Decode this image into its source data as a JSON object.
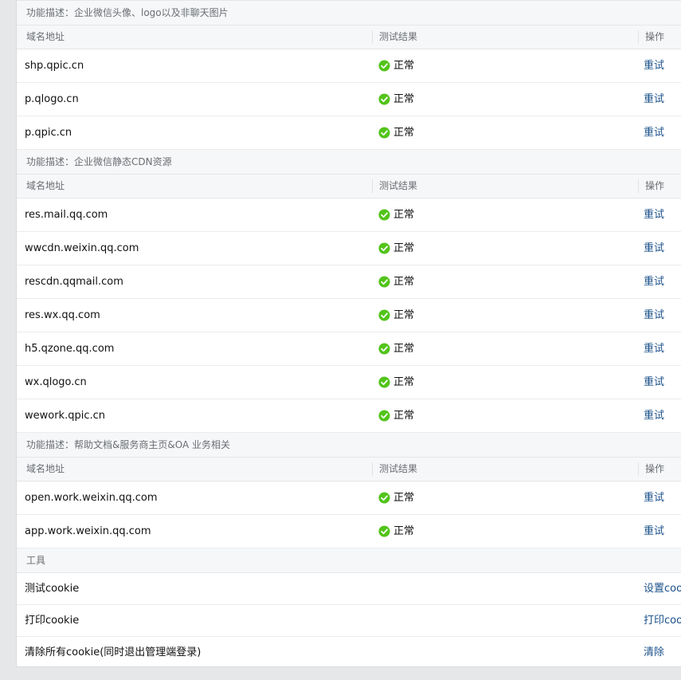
{
  "sections": [
    {
      "title": "功能描述：企业微信头像、logo以及非聊天图片",
      "headers": {
        "domain": "域名地址",
        "result": "测试结果",
        "action": "操作"
      },
      "rows": [
        {
          "domain": "shp.qpic.cn",
          "result": "正常",
          "action": "重试"
        },
        {
          "domain": "p.qlogo.cn",
          "result": "正常",
          "action": "重试"
        },
        {
          "domain": "p.qpic.cn",
          "result": "正常",
          "action": "重试"
        }
      ]
    },
    {
      "title": "功能描述：企业微信静态CDN资源",
      "headers": {
        "domain": "域名地址",
        "result": "测试结果",
        "action": "操作"
      },
      "rows": [
        {
          "domain": "res.mail.qq.com",
          "result": "正常",
          "action": "重试"
        },
        {
          "domain": "wwcdn.weixin.qq.com",
          "result": "正常",
          "action": "重试"
        },
        {
          "domain": "rescdn.qqmail.com",
          "result": "正常",
          "action": "重试"
        },
        {
          "domain": "res.wx.qq.com",
          "result": "正常",
          "action": "重试"
        },
        {
          "domain": "h5.qzone.qq.com",
          "result": "正常",
          "action": "重试"
        },
        {
          "domain": "wx.qlogo.cn",
          "result": "正常",
          "action": "重试"
        },
        {
          "domain": "wework.qpic.cn",
          "result": "正常",
          "action": "重试"
        }
      ]
    },
    {
      "title": "功能描述：帮助文档&服务商主页&OA 业务相关",
      "headers": {
        "domain": "域名地址",
        "result": "测试结果",
        "action": "操作"
      },
      "rows": [
        {
          "domain": "open.work.weixin.qq.com",
          "result": "正常",
          "action": "重试"
        },
        {
          "domain": "app.work.weixin.qq.com",
          "result": "正常",
          "action": "重试"
        }
      ]
    }
  ],
  "tools": {
    "title": "工具",
    "rows": [
      {
        "label": "测试cookie",
        "action": "设置coo"
      },
      {
        "label": "打印cookie",
        "action": "打印coo"
      },
      {
        "label": "清除所有cookie(同时退出管理端登录)",
        "action": "清除"
      }
    ]
  },
  "colors": {
    "ok_icon": "#52c41a",
    "link": "#1a5089",
    "header_bg": "#f6f7f8",
    "page_bg": "#e6e7e9"
  },
  "icons": {
    "status_ok": "check-circle-icon"
  }
}
